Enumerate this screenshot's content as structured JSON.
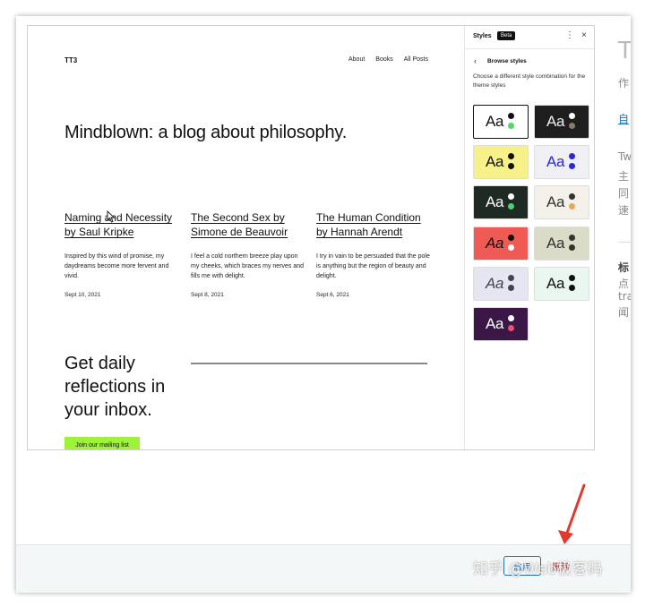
{
  "site": {
    "brand": "TT3",
    "nav": [
      "About",
      "Books",
      "All Posts"
    ],
    "hero": "Mindblown: a blog about philosophy.",
    "posts": [
      {
        "title": "Naming and Necessity by Saul Kripke",
        "excerpt": "Inspired by this wind of promise, my daydreams become more fervent and vivid.",
        "date": "Sept 10, 2021"
      },
      {
        "title": "The Second Sex by Simone de Beauvoir",
        "excerpt": "I feel a cold northern breeze play upon my cheeks, which braces my nerves and fills me with delight.",
        "date": "Sept 8, 2021"
      },
      {
        "title": "The Human Condition by Hannah Arendt",
        "excerpt": "I try in vain to be persuaded that the pole is anything but the region of beauty and delight.",
        "date": "Sept 6, 2021"
      }
    ],
    "newsletter": "Get daily reflections in your inbox.",
    "join_button": "Join our mailing list"
  },
  "styles_panel": {
    "title": "Styles",
    "badge": "Beta",
    "kebab_icon": "⋮",
    "close_icon": "×",
    "back_icon": "‹",
    "browse_label": "Browse styles",
    "description": "Choose a different style combination for the theme styles",
    "tiles": [
      {
        "label": "Aa",
        "bg": "#ffffff",
        "fg": "#111111",
        "dot1": "#111111",
        "dot2": "#4cd964",
        "border": "#111111"
      },
      {
        "label": "Aa",
        "bg": "#1e1e1e",
        "fg": "#eeeeee",
        "dot1": "#ffffff",
        "dot2": "#8a7a6a",
        "border": "#1e1e1e"
      },
      {
        "label": "Aa",
        "bg": "#f7f18a",
        "fg": "#111111",
        "dot1": "#111111",
        "dot2": "#111111",
        "border": "#f7f18a"
      },
      {
        "label": "Aa",
        "bg": "#f0f0f4",
        "fg": "#2a2ad4",
        "dot1": "#2a2ad4",
        "dot2": "#2a2ad4",
        "border": "#f0f0f4"
      },
      {
        "label": "Aa",
        "bg": "#1f2a24",
        "fg": "#ffffff",
        "dot1": "#ffffff",
        "dot2": "#4fd16f",
        "border": "#1f2a24"
      },
      {
        "label": "Aa",
        "bg": "#f4f1ea",
        "fg": "#333333",
        "dot1": "#333333",
        "dot2": "#e5a95a",
        "border": "#f4f1ea"
      },
      {
        "label": "Aa",
        "bg": "#f05a55",
        "fg": "#111111",
        "dot1": "#111111",
        "dot2": "#ffffff",
        "border": "#f05a55"
      },
      {
        "label": "Aa",
        "bg": "#dadcc7",
        "fg": "#333333",
        "dot1": "#333333",
        "dot2": "#333333",
        "border": "#dadcc7"
      },
      {
        "label": "Aa",
        "bg": "#e6e6f2",
        "fg": "#444455",
        "dot1": "#444455",
        "dot2": "#444455",
        "border": "#e6e6f2"
      },
      {
        "label": "Aa",
        "bg": "#eaf7f0",
        "fg": "#111111",
        "dot1": "#111111",
        "dot2": "#111111",
        "border": "#eaf7f0"
      },
      {
        "label": "Aa",
        "bg": "#3a1745",
        "fg": "#ffffff",
        "dot1": "#ffffff",
        "dot2": "#f0506e",
        "border": "#3a1745"
      }
    ]
  },
  "side": {
    "title_char": "T",
    "lines": [
      "作",
      "自",
      "Tw",
      "主",
      "同",
      "速",
      "标",
      "点",
      "tra",
      "闻"
    ]
  },
  "footer": {
    "apply": "启用",
    "delete": "删除"
  },
  "watermark": "知乎 @Web极客码",
  "colors": {
    "accent": "#2271b1",
    "danger": "#b32d2e",
    "join_button_bg": "#9df23a",
    "arrow": "#e03a2f"
  }
}
